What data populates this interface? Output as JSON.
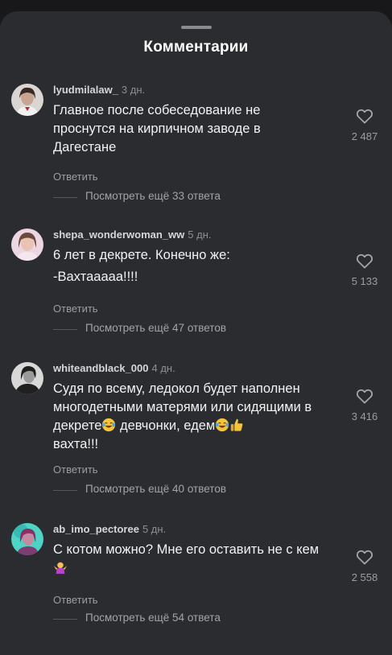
{
  "header": {
    "title": "Комментарии"
  },
  "comments": [
    {
      "username": "lyudmilalaw_",
      "time": "3 дн.",
      "text": "Главное после собеседование не проснутся на кирпичном заводе в Дагестане",
      "reply_label": "Ответить",
      "likes": "2 487",
      "more_replies": "Посмотреть ещё 33 ответа",
      "avatar_color": "#c9b8b2"
    },
    {
      "username": "shepa_wonderwoman_ww",
      "time": "5 дн.",
      "text_line1": "6 лет в декрете. Конечно же:",
      "text_line2": "-Вахтааааа!!!!",
      "reply_label": "Ответить",
      "likes": "5 133",
      "more_replies": "Посмотреть ещё 47 ответов",
      "avatar_color": "#e6c9d8"
    },
    {
      "username": "whiteandblack_000",
      "time": "4 дн.",
      "text_part1": "Судя по всему, ледокол будет наполнен многодетными матерями или сидящими в декрете",
      "text_part2": " девчонки, едем",
      "text_part3": "вахта!!!",
      "reply_label": "Ответить",
      "likes": "3 416",
      "more_replies": "Посмотреть ещё 40 ответов",
      "avatar_color": "#3a3a3c"
    },
    {
      "username": "ab_imo_pectoree",
      "time": "5 дн.",
      "text": "С котом можно? Мне его оставить не с кем",
      "reply_label": "Ответить",
      "likes": "2 558",
      "more_replies": "Посмотреть ещё 54 ответа",
      "avatar_color": "#3fd1c6"
    }
  ],
  "icons": {
    "like": "heart-outline-icon",
    "laughing": "tears-of-joy-emoji",
    "thumbs_up": "thumbs-up-emoji",
    "shrug": "shrug-emoji"
  }
}
